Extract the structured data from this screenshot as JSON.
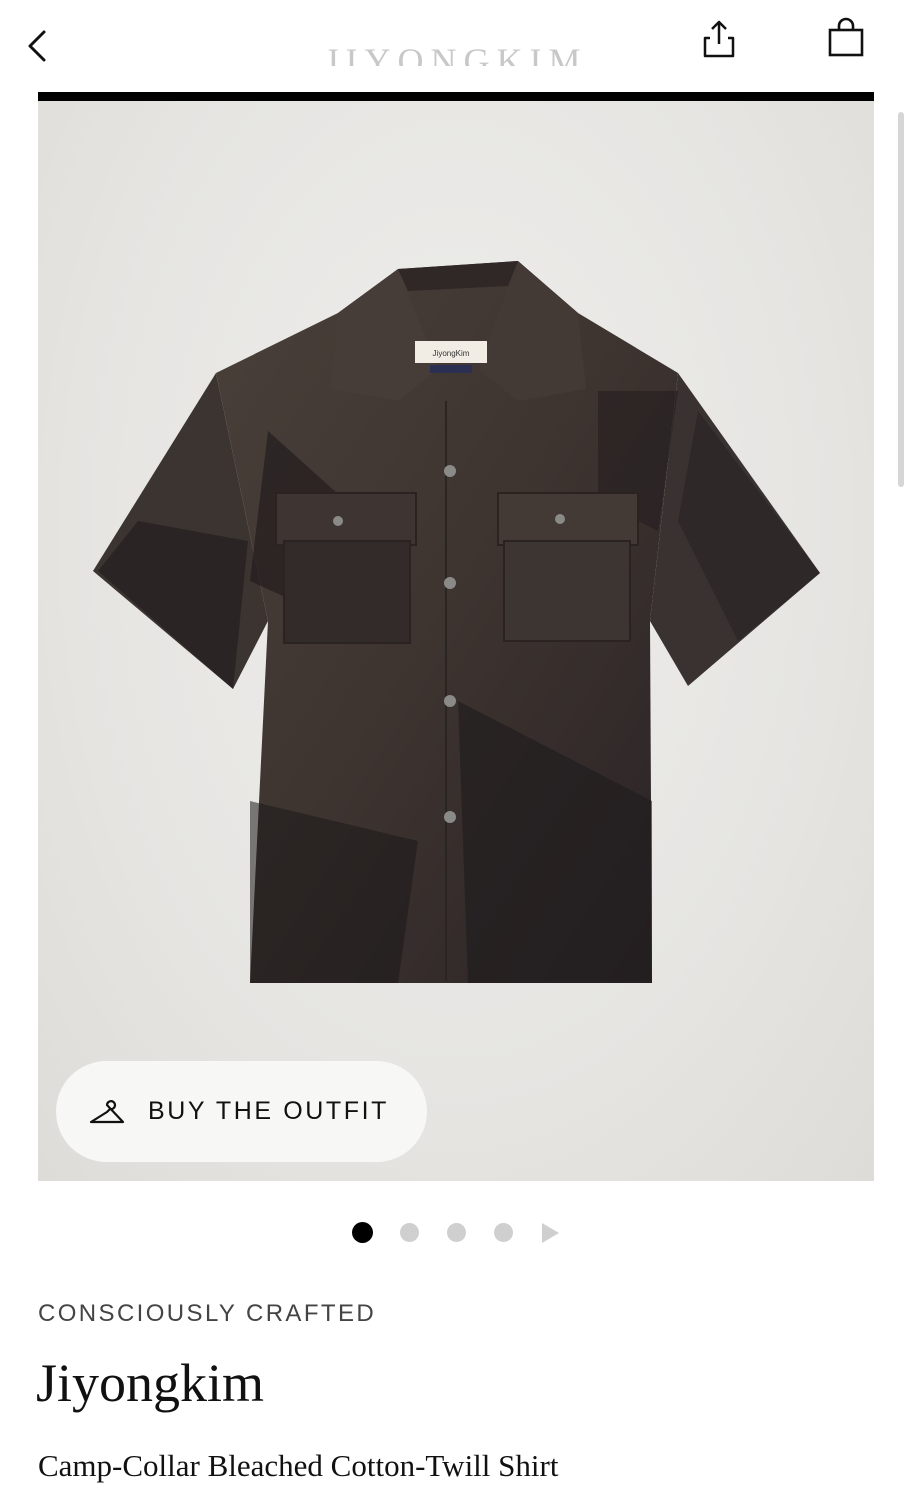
{
  "header": {
    "brand": "JIYONGKIM",
    "back_icon": "chevron-left-icon",
    "share_icon": "share-icon",
    "bag_icon": "shopping-bag-icon"
  },
  "gallery": {
    "image_alt": "Camp-collar bleached cotton-twill shirt",
    "label_text": "JiyongKim",
    "slide_count": 4,
    "active_slide": 1,
    "next_icon": "play-arrow-icon"
  },
  "outfit": {
    "label": "BUY THE OUTFIT",
    "icon": "hanger-icon"
  },
  "product": {
    "eyebrow": "CONSCIOUSLY CRAFTED",
    "designer": "Jiyongkim",
    "name": "Camp-Collar Bleached Cotton-Twill Shirt"
  },
  "colors": {
    "accent": "#000000",
    "inactive_dot": "#cfcfcf",
    "shirt": "#3a3330",
    "background": "#e9e8e6"
  }
}
